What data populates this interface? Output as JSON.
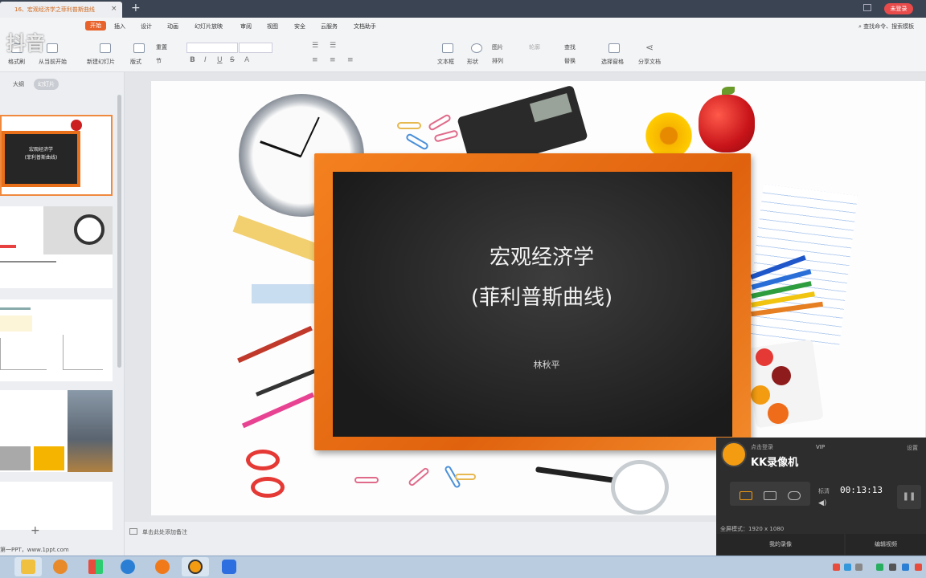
{
  "window": {
    "doc_tab_title": "16、宏观经济学之菲利普斯曲线",
    "new_tab": "+",
    "login_button": "未登录"
  },
  "menu": {
    "items": [
      "开始",
      "插入",
      "设计",
      "动画",
      "幻灯片放映",
      "审阅",
      "视图",
      "安全",
      "云服务",
      "文档助手"
    ],
    "search_placeholder": "查找命令、搜索模板"
  },
  "ribbon": {
    "format_painter": "格式刷",
    "from_current": "从当前开始",
    "new_slide": "新建幻灯片",
    "layout": "版式",
    "reset": "重置",
    "section": "节",
    "textbox": "文本框",
    "shape": "形状",
    "arrange": "排列",
    "picture": "图片",
    "outline": "轮廓",
    "find": "查找",
    "replace": "替换",
    "select_pane": "选择窗格",
    "share": "分享文档",
    "format_buttons": [
      "B",
      "I",
      "U",
      "S",
      "A"
    ]
  },
  "left_pane": {
    "outline_tab": "大纲",
    "slides_tab": "幻灯片",
    "thumb1_title": "宏观经济学",
    "thumb1_subtitle": "(菲利普斯曲线)",
    "add_slide": "+"
  },
  "slide": {
    "title": "宏观经济学",
    "subtitle": "(菲利普斯曲线)",
    "author": "林秋平"
  },
  "notes": {
    "placeholder": "单击此处添加备注"
  },
  "status": {
    "left": "第一PPT，www.1ppt.com"
  },
  "recorder": {
    "tip": "点击登录",
    "vip": "VIP",
    "settings": "设置",
    "name": "KK录像机",
    "time_label": "标清",
    "time": "00:13:13",
    "resolution": "全屏模式：1920 x 1080",
    "my_recordings": "我的录像",
    "edit_video": "编辑视频"
  },
  "watermark": "抖音",
  "colors": {
    "accent": "#e8632b",
    "frame": "#f4811f",
    "chalkboard": "#262626",
    "titlebar": "#3b4452"
  }
}
